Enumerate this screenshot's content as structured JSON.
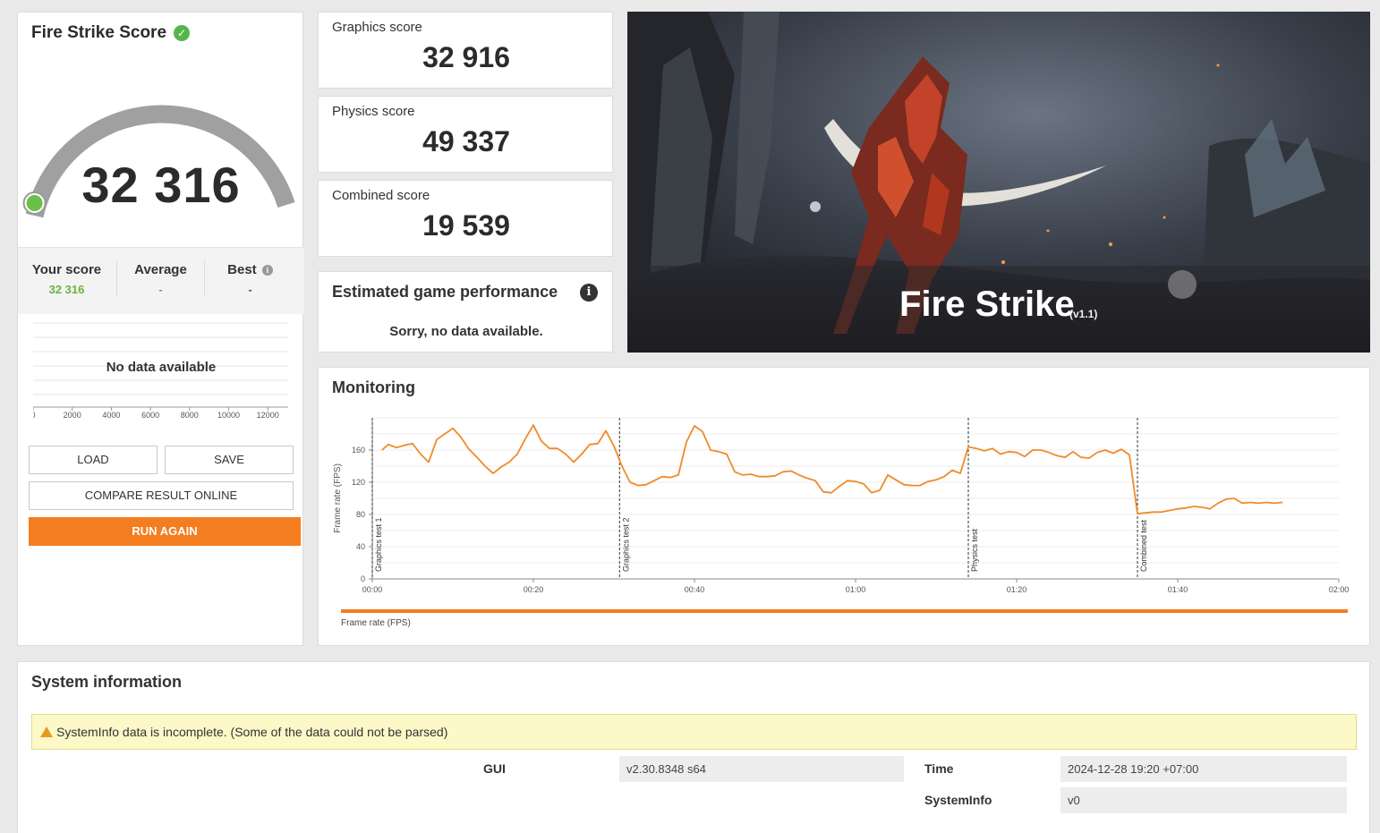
{
  "score_panel": {
    "title": "Fire Strike Score",
    "score": "32 316",
    "your_score_label": "Your score",
    "your_score_value": "32 316",
    "average_label": "Average",
    "average_value": "-",
    "best_label": "Best",
    "best_value": "-",
    "no_data": "No data available",
    "dist_ticks": [
      "0",
      "2000",
      "4000",
      "6000",
      "8000",
      "10000",
      "12000"
    ],
    "gauge_level": 0.0
  },
  "buttons": {
    "load": "LOAD",
    "save": "SAVE",
    "compare": "COMPARE RESULT ONLINE",
    "run_again": "RUN AGAIN"
  },
  "sub_scores": {
    "graphics_label": "Graphics score",
    "graphics_value": "32 916",
    "physics_label": "Physics score",
    "physics_value": "49 337",
    "combined_label": "Combined score",
    "combined_value": "19 539"
  },
  "game_perf": {
    "title": "Estimated game performance",
    "message": "Sorry, no data available."
  },
  "hero": {
    "title": "Fire Strike",
    "version": "(v1.1)"
  },
  "monitoring": {
    "title": "Monitoring",
    "legend": "Frame rate (FPS)"
  },
  "chart_data": {
    "type": "line",
    "ylabel": "Frame rate (FPS)",
    "xlim": [
      0,
      120
    ],
    "ylim": [
      0,
      200
    ],
    "yticks": [
      0,
      40,
      80,
      120,
      160
    ],
    "xticks": [
      "00:00",
      "00:20",
      "00:40",
      "01:00",
      "01:20",
      "01:40",
      "02:00"
    ],
    "markers": [
      {
        "t": 0,
        "label": "Graphics test 1"
      },
      {
        "t": 30.7,
        "label": "Graphics test 2"
      },
      {
        "t": 74,
        "label": "Physics test"
      },
      {
        "t": 95,
        "label": "Combined test"
      }
    ],
    "series": [
      {
        "color": "#f08a2a",
        "x": [
          1.2,
          2,
          3,
          4,
          5,
          6,
          7,
          8,
          9,
          10,
          11,
          12,
          13,
          14,
          15,
          16,
          17,
          18,
          19,
          20,
          21,
          22,
          23,
          24,
          25,
          26,
          27,
          28,
          29,
          30,
          31,
          32,
          33,
          34,
          35,
          36,
          37,
          38,
          39,
          40,
          41,
          42,
          43,
          44,
          45,
          46,
          47,
          48,
          49,
          50,
          51,
          52,
          53,
          54,
          55,
          56,
          57,
          58,
          59,
          60,
          61,
          62,
          63,
          64,
          65,
          66,
          67,
          68,
          69,
          70,
          71,
          72,
          73,
          74,
          75,
          76,
          77,
          78,
          79,
          80,
          81,
          82,
          83,
          84,
          85,
          86,
          87,
          88,
          89,
          90,
          91,
          92,
          93,
          94,
          95,
          96,
          97,
          98,
          99,
          100,
          101,
          102,
          103,
          104,
          105,
          106,
          107,
          108,
          109,
          110,
          111,
          112,
          113
        ],
        "y": [
          160,
          167,
          163,
          166,
          168,
          155,
          145,
          173,
          180,
          187,
          176,
          161,
          151,
          140,
          131,
          139,
          145,
          155,
          174,
          191,
          171,
          162,
          162,
          155,
          145,
          155,
          167,
          168,
          184,
          165,
          140,
          120,
          116,
          117,
          122,
          127,
          126,
          129,
          170,
          190,
          183,
          160,
          158,
          155,
          133,
          129,
          130,
          127,
          127,
          128,
          133,
          134,
          129,
          125,
          122,
          108,
          107,
          115,
          122,
          121,
          118,
          107,
          110,
          129,
          123,
          117,
          116,
          116,
          121,
          123,
          127,
          135,
          131,
          164,
          162,
          159,
          162,
          155,
          158,
          157,
          152,
          160,
          160,
          157,
          153,
          151,
          158,
          151,
          150,
          157,
          160,
          156,
          161,
          154,
          81,
          82,
          83,
          83,
          85,
          87,
          88,
          90,
          89,
          87,
          94,
          99,
          100,
          94,
          95,
          94,
          95,
          94,
          95
        ]
      }
    ]
  },
  "sysinfo": {
    "title": "System information",
    "warning": "SystemInfo data is incomplete. (Some of the data could not be parsed)",
    "gui_label": "GUI",
    "gui_value": "v2.30.8348 s64",
    "time_label": "Time",
    "time_value": "2024-12-28 19:20 +07:00",
    "systeminfo_label": "SystemInfo",
    "systeminfo_value": "v0"
  },
  "colors": {
    "accent": "#f47d20",
    "line": "#f08a2a",
    "good": "#55b54a",
    "gauge": "#a0a0a0"
  }
}
